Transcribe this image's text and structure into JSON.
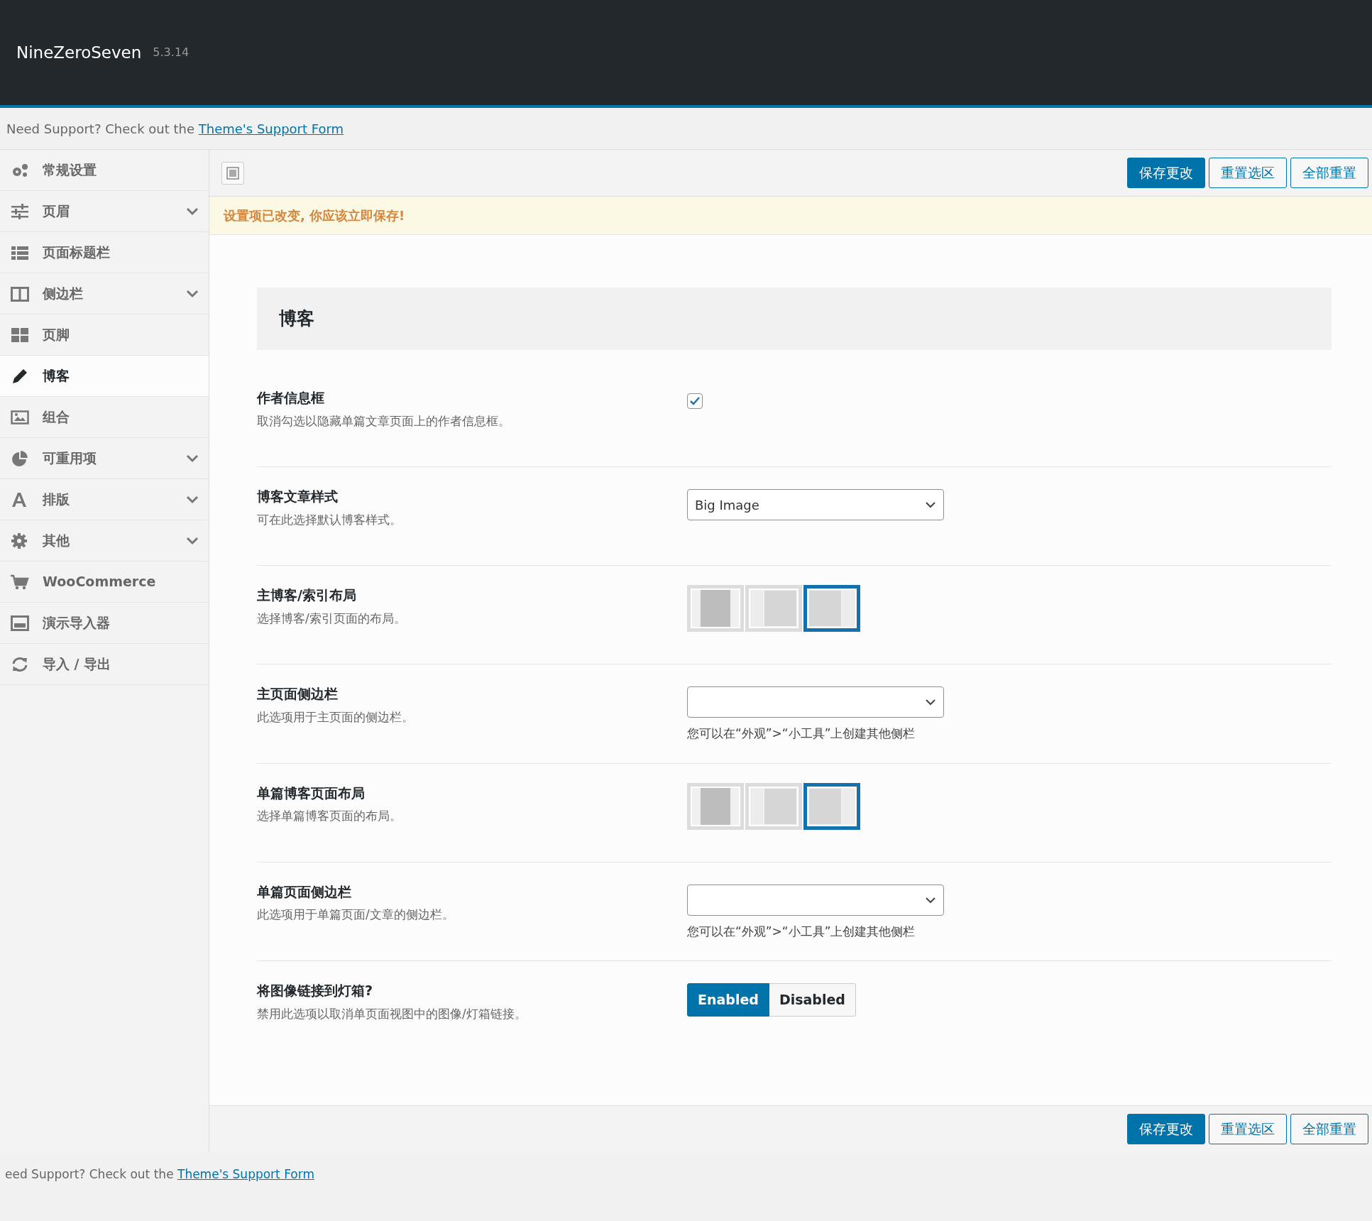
{
  "header": {
    "title": "NineZeroSeven",
    "version": "5.3.14"
  },
  "support_top": {
    "text": "Need Support? Check out the",
    "link": "Theme's Support Form"
  },
  "sidebar": {
    "items": [
      {
        "label": "常规设置",
        "expandable": false,
        "selected": false
      },
      {
        "label": "页眉",
        "expandable": true,
        "selected": false
      },
      {
        "label": "页面标题栏",
        "expandable": false,
        "selected": false
      },
      {
        "label": "侧边栏",
        "expandable": true,
        "selected": false
      },
      {
        "label": "页脚",
        "expandable": false,
        "selected": false
      },
      {
        "label": "博客",
        "expandable": false,
        "selected": true
      },
      {
        "label": "组合",
        "expandable": false,
        "selected": false
      },
      {
        "label": "可重用项",
        "expandable": true,
        "selected": false
      },
      {
        "label": "排版",
        "expandable": true,
        "selected": false
      },
      {
        "label": "其他",
        "expandable": true,
        "selected": false
      },
      {
        "label": "WooCommerce",
        "expandable": false,
        "selected": false
      },
      {
        "label": "演示导入器",
        "expandable": false,
        "selected": false
      },
      {
        "label": "导入 / 导出",
        "expandable": false,
        "selected": false
      }
    ]
  },
  "toolbar": {
    "buttons": [
      {
        "label": "保存更改",
        "kind": "primary"
      },
      {
        "label": "重置选区",
        "kind": "outline"
      },
      {
        "label": "全部重置",
        "kind": "outline"
      }
    ]
  },
  "notice": "设置项已改变, 你应该立即保存!",
  "section": {
    "title": "博客"
  },
  "settings": [
    {
      "kind": "checkbox",
      "label": "作者信息框",
      "description": "取消勾选以隐藏单篇文章页面上的作者信息框。",
      "checked": true
    },
    {
      "kind": "select",
      "label": "博客文章样式",
      "description": "可在此选择默认博客样式。",
      "value": "Big Image"
    },
    {
      "kind": "layout",
      "label": "主博客/索引布局",
      "description": "选择博客/索引页面的布局。",
      "options": [
        {
          "kind": "full",
          "selected": false
        },
        {
          "kind": "left",
          "selected": false
        },
        {
          "kind": "right",
          "selected": true
        }
      ]
    },
    {
      "kind": "select",
      "label": "主页面侧边栏",
      "description": "此选项用于主页面的侧边栏。",
      "help": "您可以在“外观”>“小工具”上创建其他侧栏"
    },
    {
      "kind": "layout",
      "label": "单篇博客页面布局",
      "description": "选择单篇博客页面的布局。",
      "options": [
        {
          "kind": "full",
          "selected": false
        },
        {
          "kind": "left",
          "selected": false
        },
        {
          "kind": "right",
          "selected": true
        }
      ]
    },
    {
      "kind": "select",
      "label": "单篇页面侧边栏",
      "description": "此选项用于单篇页面/文章的侧边栏。",
      "help": "您可以在“外观”>“小工具”上创建其他侧栏"
    },
    {
      "kind": "toggle",
      "label": "将图像链接到灯箱?",
      "description": "禁用此选项以取消单页面视图中的图像/灯箱链接。",
      "options": [
        {
          "label": "Enabled",
          "selected": true
        },
        {
          "label": "Disabled",
          "selected": false
        }
      ]
    }
  ],
  "footer_buttons": [
    {
      "label": "保存更改",
      "kind": "primary"
    },
    {
      "label": "重置选区",
      "kind": "outline"
    },
    {
      "label": "全部重置",
      "kind": "outline"
    }
  ],
  "support_bottom": {
    "text": "eed Support? Check out the",
    "link": "Theme's Support Form"
  }
}
